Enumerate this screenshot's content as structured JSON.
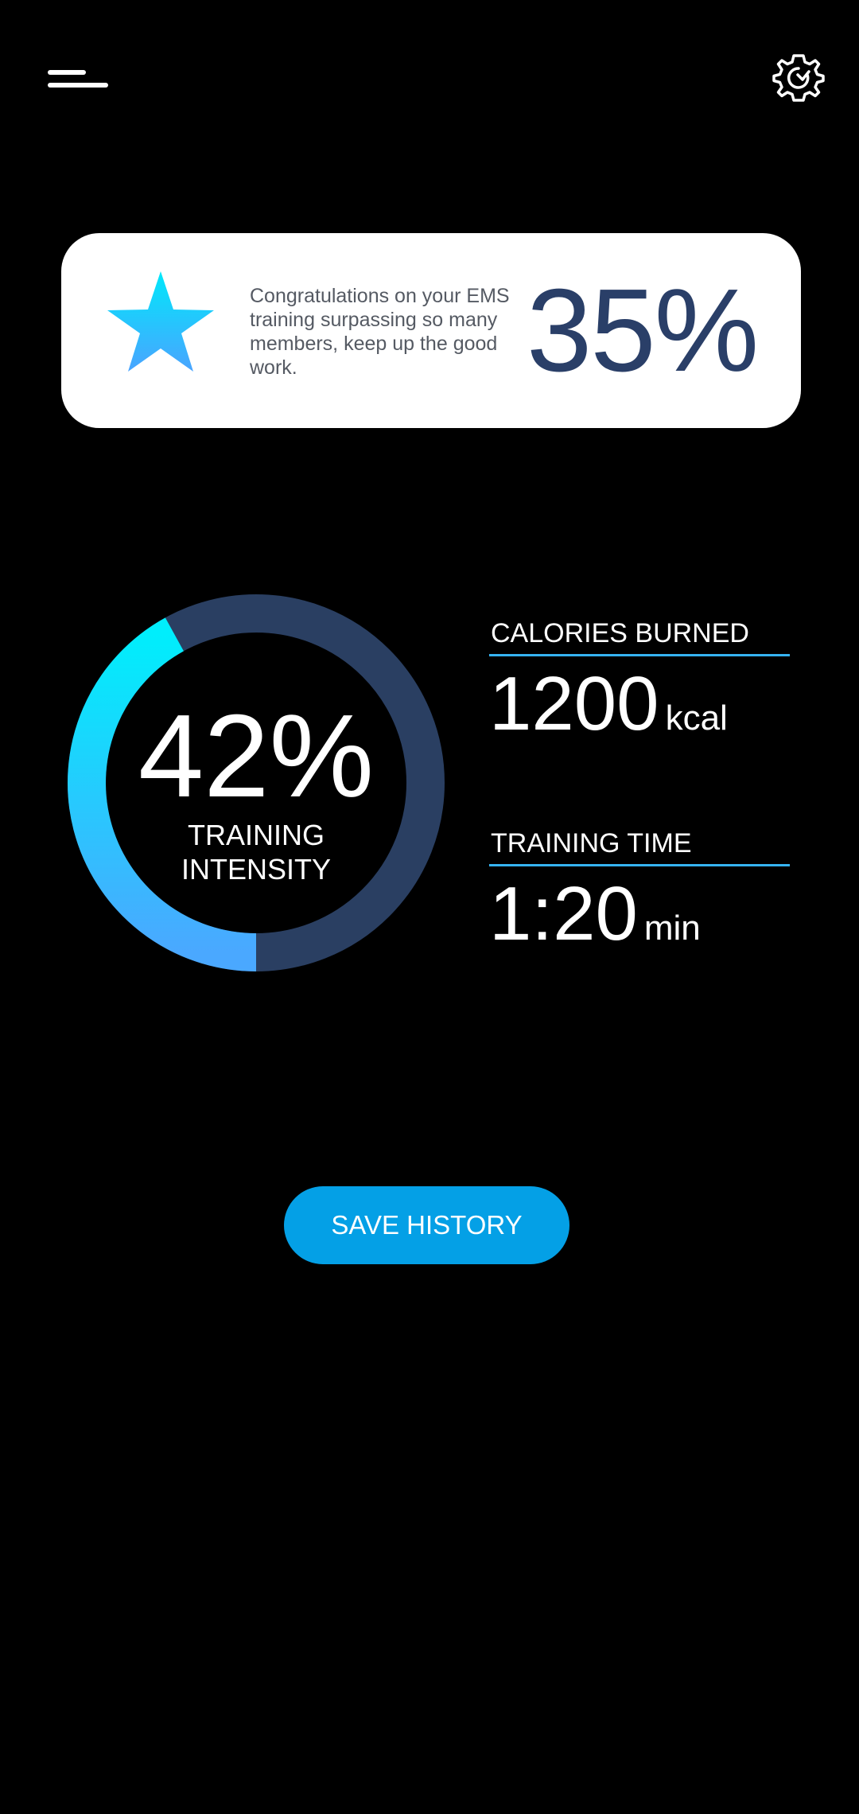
{
  "header": {
    "menu_icon": "menu-icon",
    "settings_icon": "gear-icon"
  },
  "congrats_card": {
    "icon": "star-icon",
    "message": "Congratulations on your EMS training surpassing so many members, keep up the good work.",
    "percentage": "35%"
  },
  "intensity": {
    "value_text": "42%",
    "fraction": 0.42,
    "label": "TRAINING INTENSITY"
  },
  "stats": {
    "calories": {
      "label": "CALORIES BURNED",
      "value": "1200",
      "unit": "kcal"
    },
    "time": {
      "label": "TRAINING TIME",
      "value": "1:20",
      "unit": "min"
    }
  },
  "actions": {
    "save_label": "SAVE HISTORY"
  },
  "colors": {
    "background": "#000000",
    "card_background": "#ffffff",
    "card_text": "#555a63",
    "card_percentage": "#2a3f68",
    "ring_track": "#2a3f62",
    "ring_gradient_start": "#00eefc",
    "ring_gradient_end": "#4aa8ff",
    "divider": "#36b3f3",
    "button": "#04a0e6"
  }
}
